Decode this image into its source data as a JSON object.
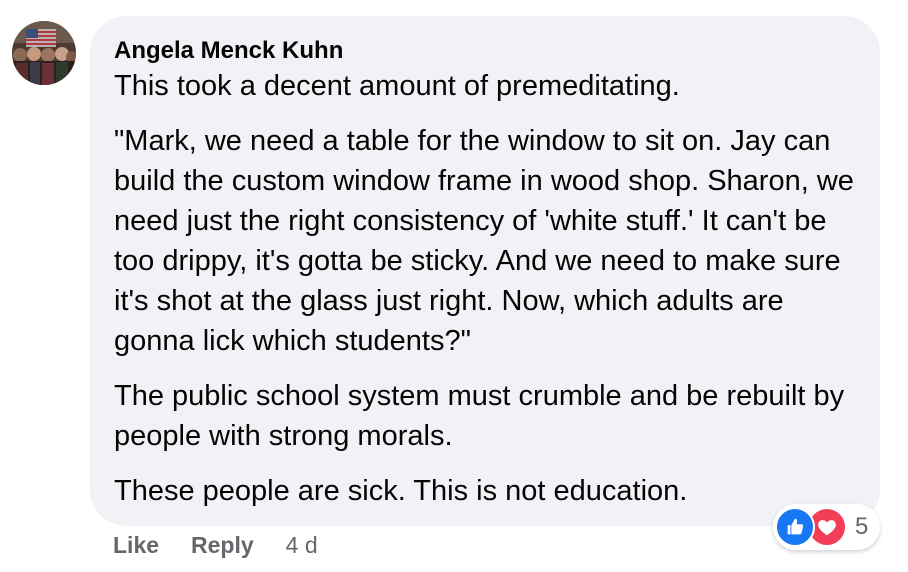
{
  "comment": {
    "author": "Angela Menck Kuhn",
    "paragraphs": [
      "This took a decent amount of premeditating.",
      "\"Mark, we need a table for the window to sit on. Jay can build the custom window frame in wood shop. Sharon, we need just the right consistency of 'white stuff.' It can't be too drippy, it's gotta be sticky. And we need to make sure it's shot at the glass just right. Now, which adults are gonna lick which students?\"",
      "The public school system must crumble and be rebuilt by people with strong morals.",
      "These people are sick. This is not education."
    ]
  },
  "actions": {
    "like_label": "Like",
    "reply_label": "Reply",
    "timestamp": "4 d"
  },
  "reactions": {
    "count": "5",
    "icons": [
      "like-icon",
      "love-icon"
    ],
    "like_color": "#1877f2",
    "love_color": "#f33e58"
  },
  "colors": {
    "bubble_bg": "#f0f2f5",
    "text": "#050505",
    "secondary_text": "#65676b"
  }
}
